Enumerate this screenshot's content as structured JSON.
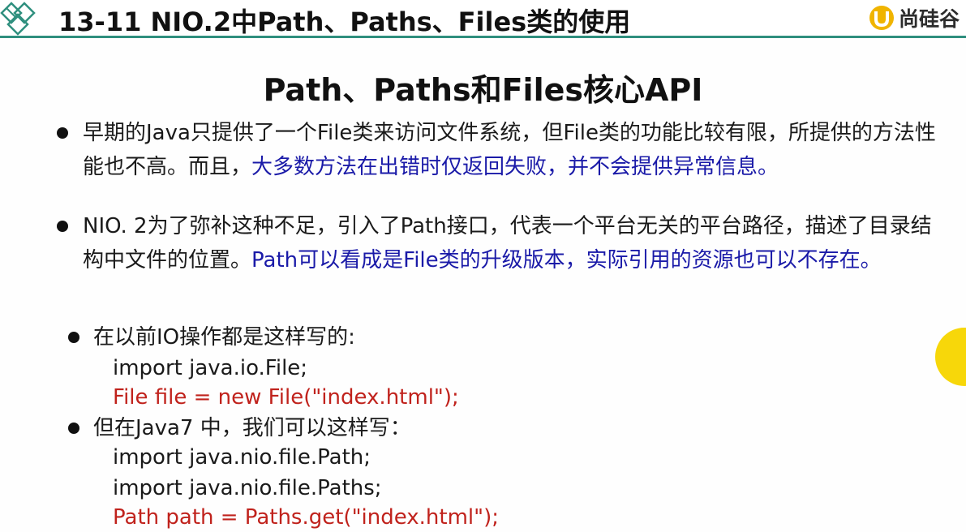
{
  "header": {
    "title": "13-11 NIO.2中Path、Paths、Files类的使用",
    "brand": "尚硅谷"
  },
  "content": {
    "heading": "Path、Paths和Files核心API",
    "bullet1": {
      "normal": "早期的Java只提供了一个File类来访问文件系统，但File类的功能比较有限，所提供的方法性能也不高。而且，",
      "highlight": "大多数方法在出错时仅返回失败，并不会提供异常信息。"
    },
    "bullet2": {
      "normal": "NIO. 2为了弥补这种不足，引入了Path接口，代表一个平台无关的平台路径，描述了目录结构中文件的位置。",
      "highlight": "Path可以看成是File类的升级版本，实际引用的资源也可以不存在。"
    },
    "bullet3": {
      "label": "在以前IO操作都是这样写的:",
      "code1": "import java.io.File;",
      "code2": "File file = new File(\"index.html\");"
    },
    "bullet4": {
      "label": "但在Java7 中，我们可以这样写：",
      "code1": "import java.nio.file.Path;",
      "code2": "import java.nio.file.Paths;",
      "code3": "Path path = Paths.get(\"index.html\");"
    }
  },
  "colors": {
    "accent_line": "#2f8f7e",
    "highlight_blue": "#1a1aa8",
    "code_red": "#c0221c",
    "marker_yellow": "#f7d70a"
  },
  "icons": {
    "left_logo": "diamond-grid-logo",
    "brand_logo": "u-shield-logo"
  }
}
